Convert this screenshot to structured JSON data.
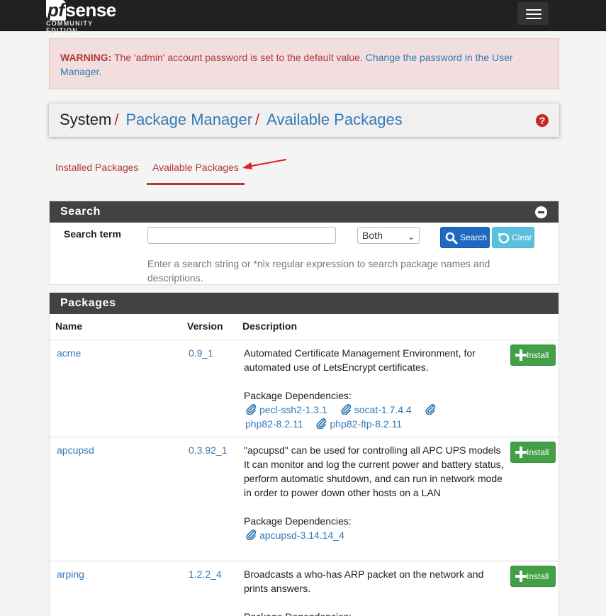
{
  "brand": {
    "logo_main": "sense",
    "logo_prefix": "pf",
    "logo_sub": "COMMUNITY EDITION"
  },
  "warning": {
    "label": "WARNING:",
    "text": " The 'admin' account password is set to the default value. ",
    "link": "Change the password in the User Manager."
  },
  "breadcrumb": {
    "system": "System",
    "sep": "/",
    "package_manager": "Package Manager",
    "available": "Available Packages"
  },
  "tabs": {
    "installed": "Installed Packages",
    "available": "Available Packages"
  },
  "search": {
    "heading": "Search",
    "term_label": "Search term",
    "term_value": "",
    "scope": "Both",
    "search_btn": "Search",
    "clear_btn": "Clear",
    "help": "Enter a search string or *nix regular expression to search package names and descriptions."
  },
  "packages": {
    "heading": "Packages",
    "columns": {
      "name": "Name",
      "version": "Version",
      "description": "Description"
    },
    "install_label": "Install",
    "deps_label": "Package Dependencies:",
    "rows": [
      {
        "name": "acme",
        "version": "0.9_1",
        "description": "Automated Certificate Management Environment, for automated use of LetsEncrypt certificates.",
        "deps": [
          "pecl-ssh2-1.3.1",
          "socat-1.7.4.4",
          "php82-8.2.11",
          "php82-ftp-8.2.11"
        ]
      },
      {
        "name": "apcupsd",
        "version": "0.3.92_1",
        "description": "\"apcupsd\" can be used for controlling all APC UPS models It can monitor and log the current power and battery status, perform automatic shutdown, and can run in network mode in order to power down other hosts on a LAN",
        "deps": [
          "apcupsd-3.14.14_4"
        ]
      },
      {
        "name": "arping",
        "version": "1.2.2_4",
        "description": "Broadcasts a who-has ARP packet on the network and prints answers.",
        "deps": []
      }
    ]
  },
  "colors": {
    "accent_red": "#b13939",
    "link_blue": "#337ab7",
    "install_green": "#43a047",
    "header_dark": "#424242"
  }
}
